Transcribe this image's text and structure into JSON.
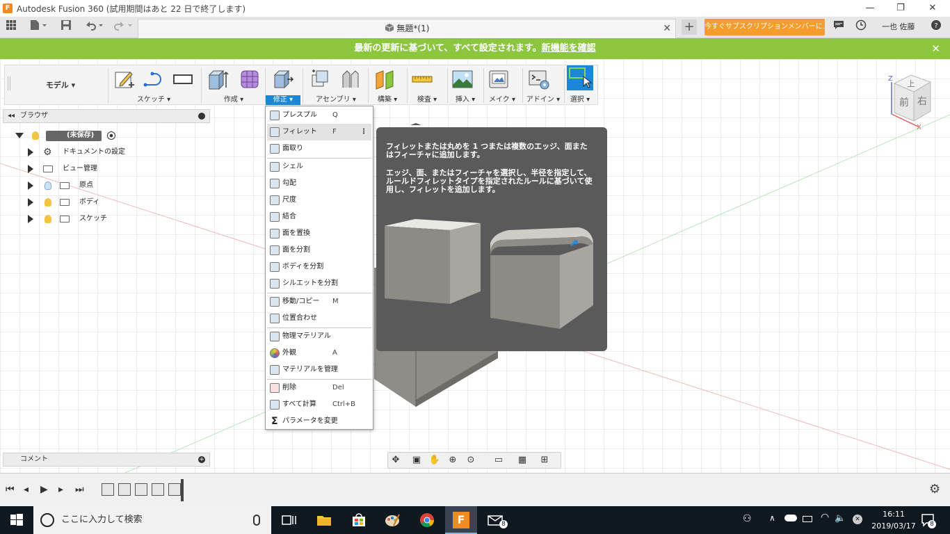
{
  "window": {
    "title": "Autodesk Fusion 360 (試用期間はあと 22 日で終了します)",
    "app_icon_letter": "F",
    "minimize": "—",
    "maximize": "❐",
    "close": "✕"
  },
  "tabbar": {
    "doc_title": "無題*(1)",
    "close_glyph": "✕",
    "new_tab": "+",
    "subscribe_label": "今すぐサブスクリプションメンバーに...",
    "user_name": "一也 佐藤",
    "help": "?"
  },
  "banner": {
    "text": "最新の更新に基づいて、すべて設定されます。",
    "link": "新機能を確認",
    "close": "✕"
  },
  "toolbar": {
    "model_label": "モデル ▾",
    "groups": [
      {
        "label": "スケッチ ▾"
      },
      {
        "label": "作成 ▾"
      },
      {
        "label": "修正 ▾"
      },
      {
        "label": "アセンブリ ▾"
      },
      {
        "label": "構築 ▾"
      },
      {
        "label": "検査 ▾"
      },
      {
        "label": "挿入 ▾"
      },
      {
        "label": "メイク ▾"
      },
      {
        "label": "アドイン ▾"
      },
      {
        "label": "選択 ▾"
      }
    ]
  },
  "browser": {
    "title": "ブラウザ",
    "collapse": "◂◂",
    "items": [
      {
        "label": "(未保存)"
      },
      {
        "label": "ドキュメントの設定"
      },
      {
        "label": "ビュー管理"
      },
      {
        "label": "原点"
      },
      {
        "label": "ボディ"
      },
      {
        "label": "スケッチ"
      }
    ]
  },
  "comments": {
    "title": "コメント"
  },
  "modify_menu": {
    "items": [
      {
        "label": "プレスプル",
        "shortcut": "Q"
      },
      {
        "label": "フィレット",
        "shortcut": "F"
      },
      {
        "label": "面取り",
        "shortcut": ""
      },
      {
        "label": "シェル",
        "shortcut": ""
      },
      {
        "label": "勾配",
        "shortcut": ""
      },
      {
        "label": "尺度",
        "shortcut": ""
      },
      {
        "label": "結合",
        "shortcut": ""
      },
      {
        "label": "面を置換",
        "shortcut": ""
      },
      {
        "label": "面を分割",
        "shortcut": ""
      },
      {
        "label": "ボディを分割",
        "shortcut": ""
      },
      {
        "label": "シルエットを分割",
        "shortcut": ""
      },
      {
        "label": "移動/コピー",
        "shortcut": "M"
      },
      {
        "label": "位置合わせ",
        "shortcut": ""
      },
      {
        "label": "物理マテリアル",
        "shortcut": ""
      },
      {
        "label": "外観",
        "shortcut": "A"
      },
      {
        "label": "マテリアルを管理",
        "shortcut": ""
      },
      {
        "label": "削除",
        "shortcut": "Del"
      },
      {
        "label": "すべて計算",
        "shortcut": "Ctrl+B"
      },
      {
        "label": "パラメータを変更",
        "shortcut": ""
      }
    ],
    "more_glyph": "⋮"
  },
  "tooltip": {
    "line1": "フィレットまたは丸めを 1 つまたは複数のエッジ、面またはフィーチャに追加します。",
    "line2": "エッジ、面、またはフィーチャを選択し、半径を指定して、ルールドフィレットタイプを指定されたルールに基づいて使用し、フィレットを追加します。"
  },
  "viewcube": {
    "top": "上",
    "front": "前",
    "right": "右",
    "axis_z": "Z",
    "axis_x": "X"
  },
  "taskbar": {
    "search_placeholder": "ここに入力して検索",
    "time": "16:11",
    "date": "2019/03/17",
    "notification_count": "8",
    "mail_badge": "8"
  }
}
